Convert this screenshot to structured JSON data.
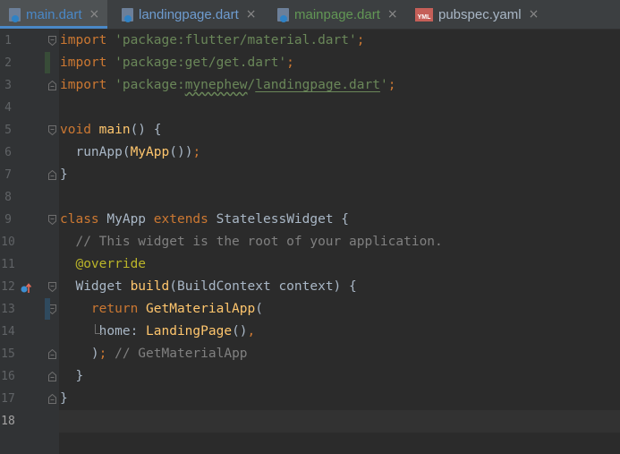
{
  "tabs": [
    {
      "name": "main.dart",
      "icon": "dart-file-icon",
      "color": "#4a88c7",
      "active": true
    },
    {
      "name": "landingpage.dart",
      "icon": "dart-file-icon",
      "color": "#6e9cd0",
      "active": false
    },
    {
      "name": "mainpage.dart",
      "icon": "dart-file-icon",
      "color": "#629755",
      "active": false
    },
    {
      "name": "pubspec.yaml",
      "icon": "yaml-file-icon",
      "badge": "YML",
      "color": "#a9b7c6",
      "active": false
    }
  ],
  "close_glyph": "×",
  "editor": {
    "current_line": 18,
    "lines": [
      {
        "n": "1",
        "parts": [
          {
            "t": "import ",
            "c": "kw"
          },
          {
            "t": "'package:flutter/material.dart'",
            "c": "str"
          },
          {
            "t": ";",
            "c": "kw"
          }
        ]
      },
      {
        "n": "2",
        "parts": [
          {
            "t": "import ",
            "c": "kw"
          },
          {
            "t": "'package:get/get.dart'",
            "c": "str"
          },
          {
            "t": ";",
            "c": "kw"
          }
        ]
      },
      {
        "n": "3",
        "parts": [
          {
            "t": "import ",
            "c": "kw"
          },
          {
            "t": "'package:",
            "c": "str"
          },
          {
            "t": "mynephew",
            "c": "str typo"
          },
          {
            "t": "/",
            "c": "str"
          },
          {
            "t": "landingpage.dart",
            "c": "str under"
          },
          {
            "t": "'",
            "c": "str"
          },
          {
            "t": ";",
            "c": "kw"
          }
        ]
      },
      {
        "n": "4",
        "parts": []
      },
      {
        "n": "5",
        "parts": [
          {
            "t": "void ",
            "c": "kw"
          },
          {
            "t": "main",
            "c": "fn"
          },
          {
            "t": "() {",
            "c": ""
          }
        ]
      },
      {
        "n": "6",
        "parts": [
          {
            "t": "  runApp(",
            "c": ""
          },
          {
            "t": "MyApp",
            "c": "fn"
          },
          {
            "t": "())",
            "c": ""
          },
          {
            "t": ";",
            "c": "kw"
          }
        ]
      },
      {
        "n": "7",
        "parts": [
          {
            "t": "}",
            "c": ""
          }
        ]
      },
      {
        "n": "8",
        "parts": []
      },
      {
        "n": "9",
        "parts": [
          {
            "t": "class ",
            "c": "kw"
          },
          {
            "t": "MyApp ",
            "c": ""
          },
          {
            "t": "extends ",
            "c": "kw"
          },
          {
            "t": "StatelessWidget {",
            "c": ""
          }
        ]
      },
      {
        "n": "10",
        "parts": [
          {
            "t": "  // This widget is the root of your application.",
            "c": "cmt"
          }
        ]
      },
      {
        "n": "11",
        "parts": [
          {
            "t": "  @override",
            "c": "ann"
          }
        ]
      },
      {
        "n": "12",
        "parts": [
          {
            "t": "  Widget ",
            "c": ""
          },
          {
            "t": "build",
            "c": "fn"
          },
          {
            "t": "(BuildContext context) {",
            "c": ""
          }
        ]
      },
      {
        "n": "13",
        "parts": [
          {
            "t": "    return ",
            "c": "kw"
          },
          {
            "t": "GetMaterialApp",
            "c": "fn"
          },
          {
            "t": "(",
            "c": ""
          }
        ]
      },
      {
        "n": "14",
        "parts": [
          {
            "t": "     home: ",
            "c": ""
          },
          {
            "t": "LandingPage",
            "c": "fn"
          },
          {
            "t": "()",
            "c": ""
          },
          {
            "t": ",",
            "c": "kw"
          }
        ]
      },
      {
        "n": "15",
        "parts": [
          {
            "t": "    )",
            "c": ""
          },
          {
            "t": ";",
            "c": "kw"
          },
          {
            "t": " // GetMaterialApp",
            "c": "cmt"
          }
        ]
      },
      {
        "n": "16",
        "parts": [
          {
            "t": "  }",
            "c": ""
          }
        ]
      },
      {
        "n": "17",
        "parts": [
          {
            "t": "}",
            "c": ""
          }
        ]
      },
      {
        "n": "18",
        "parts": []
      }
    ]
  }
}
